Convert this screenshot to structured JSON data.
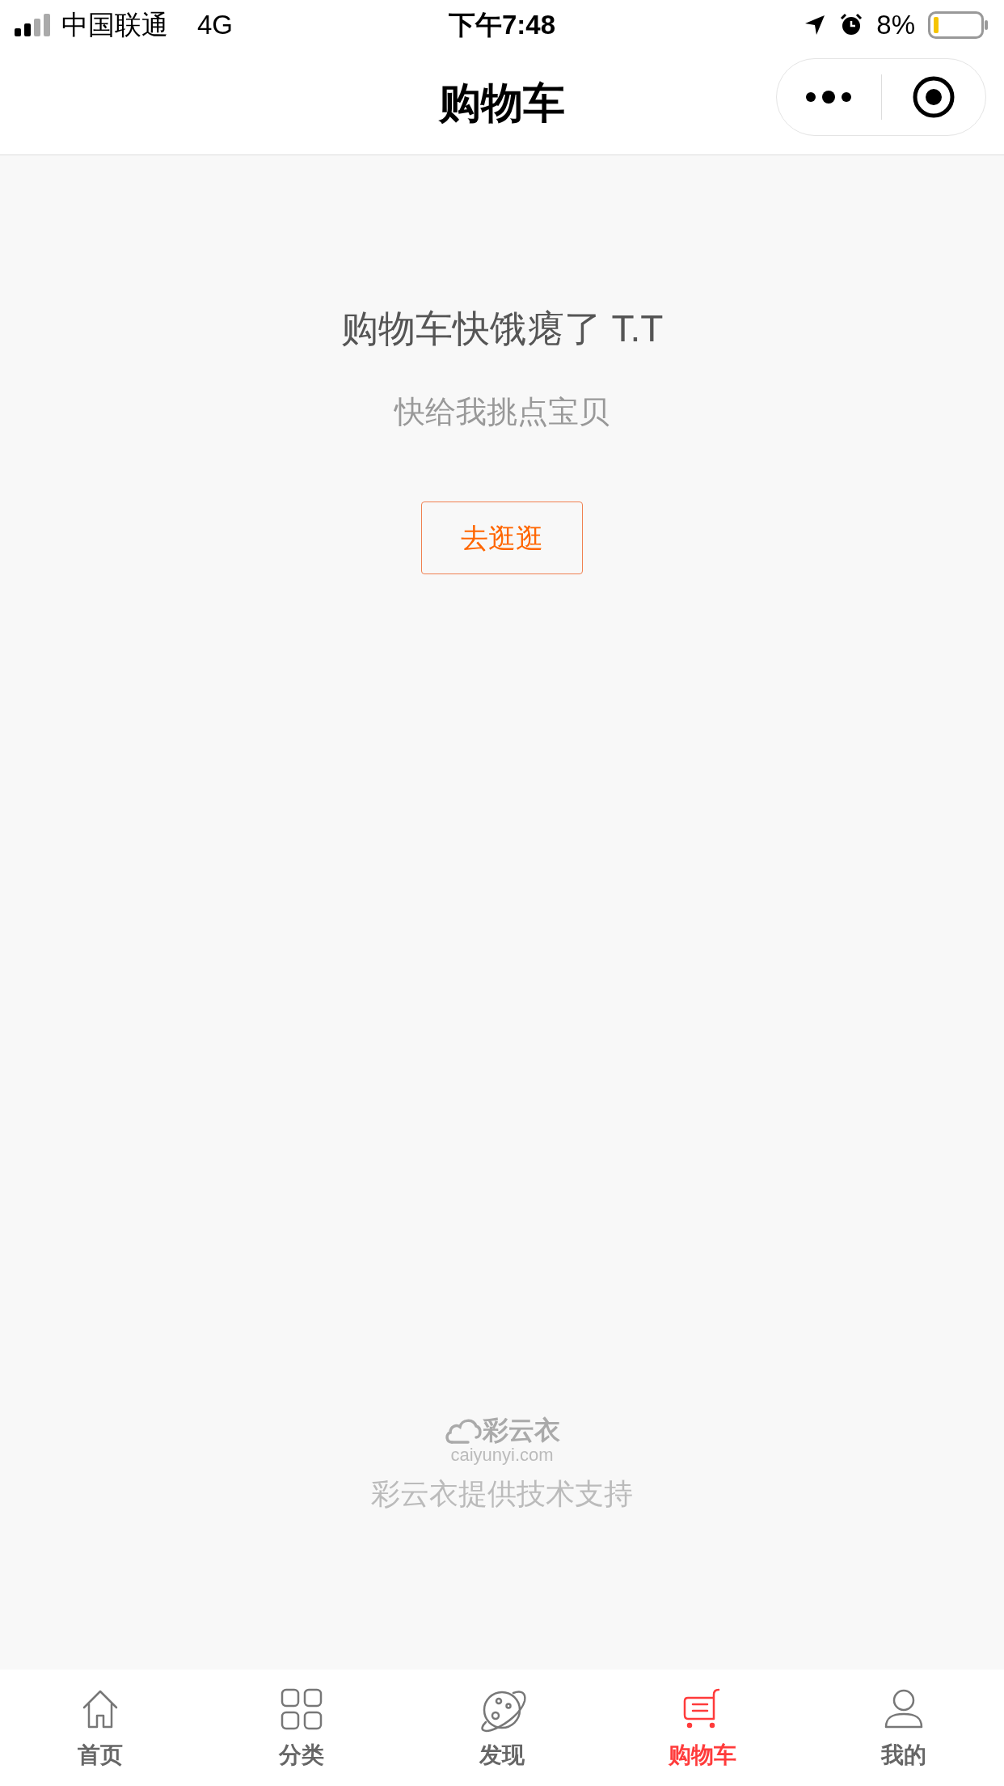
{
  "status_bar": {
    "carrier": "中国联通",
    "network": "4G",
    "time": "下午7:48",
    "battery": "8%"
  },
  "nav_bar": {
    "title": "购物车"
  },
  "empty_state": {
    "title": "购物车快饿瘪了 T.T",
    "subtitle": "快给我挑点宝贝",
    "button": "去逛逛"
  },
  "footer": {
    "logo_name": "彩云衣",
    "logo_domain": "caiyunyi.com",
    "credit": "彩云衣提供技术支持"
  },
  "tab_bar": [
    {
      "label": "首页",
      "kind": "home",
      "selected": false
    },
    {
      "label": "分类",
      "kind": "category",
      "selected": false
    },
    {
      "label": "发现",
      "kind": "discover",
      "selected": false
    },
    {
      "label": "购物车",
      "kind": "cart",
      "selected": true
    },
    {
      "label": "我的",
      "kind": "profile",
      "selected": false
    }
  ]
}
